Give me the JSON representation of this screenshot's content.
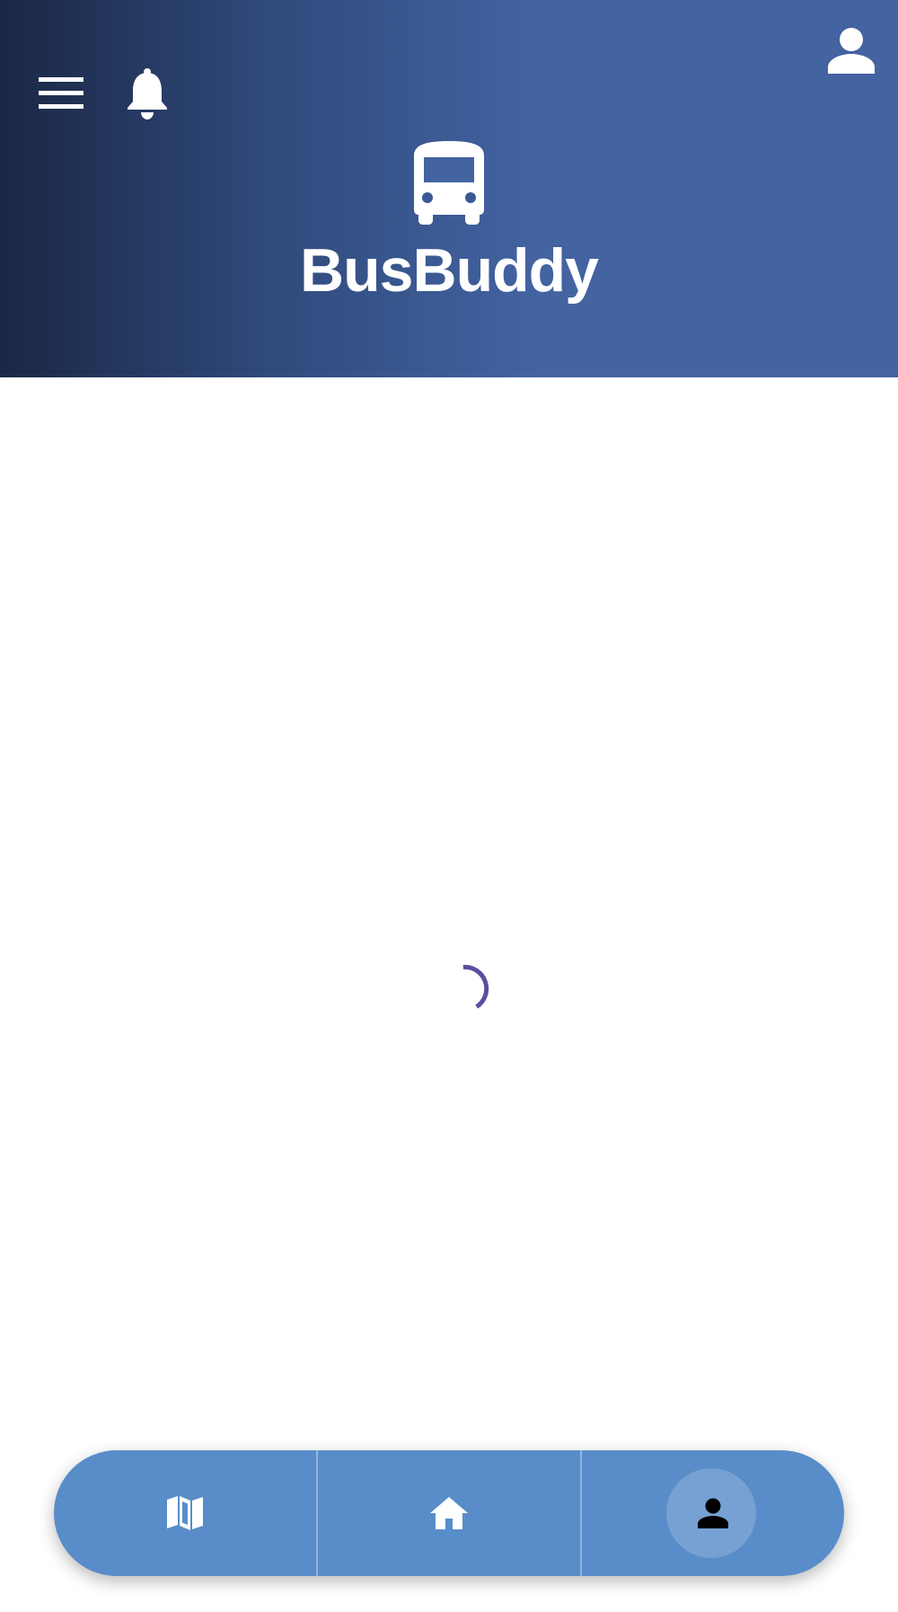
{
  "header": {
    "app_title": "BusBuddy",
    "background_gradient": [
      "#1b2744",
      "#4363a1"
    ],
    "icons": {
      "menu": "hamburger-menu-icon",
      "notifications": "bell-icon",
      "profile": "person-icon",
      "logo": "bus-icon"
    }
  },
  "main": {
    "loading": true,
    "spinner_color": "#5b4ea0"
  },
  "bottom_nav": {
    "background": "#588dc9",
    "items": [
      {
        "icon": "map-icon",
        "active": false
      },
      {
        "icon": "home-icon",
        "active": false
      },
      {
        "icon": "person-icon",
        "active": true
      }
    ]
  }
}
